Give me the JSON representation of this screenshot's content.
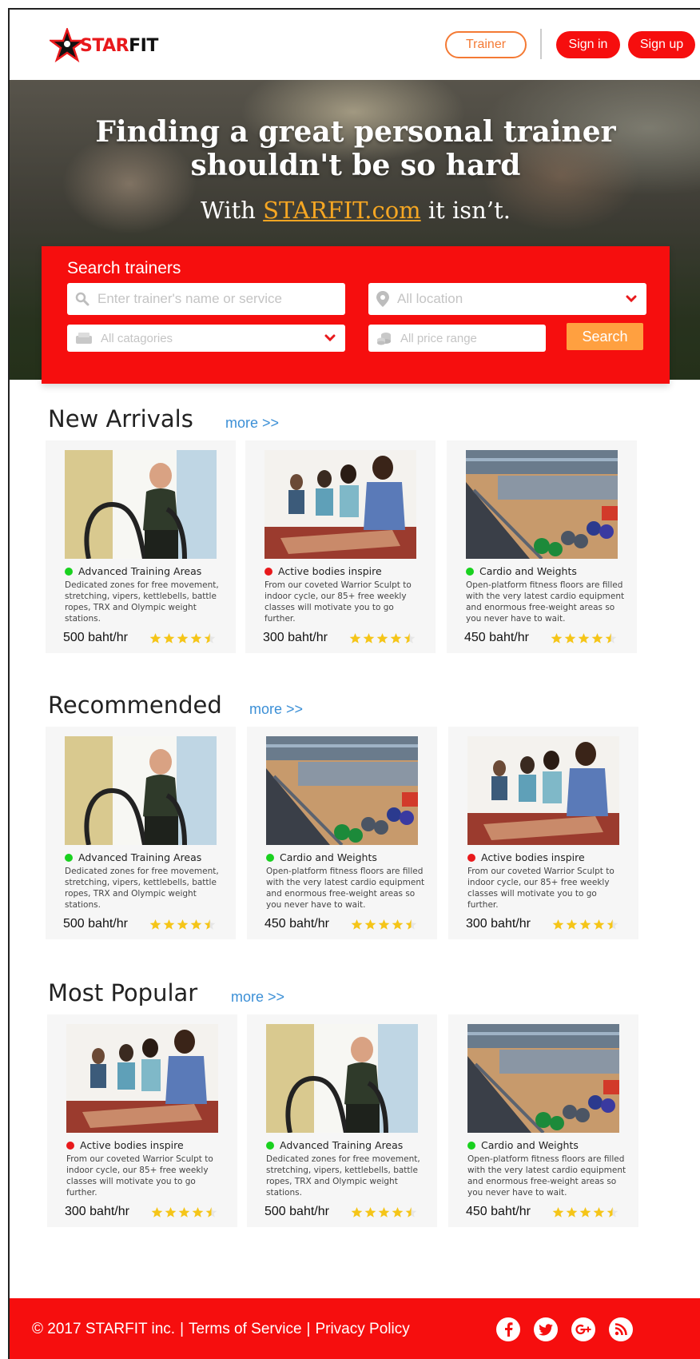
{
  "header": {
    "logo_text_prefix": "STAR",
    "logo_text_suffix": "FIT",
    "trainer_label": "Trainer",
    "signin_label": "Sign in",
    "signup_label": "Sign up"
  },
  "hero": {
    "title_line1": "Finding a great personal trainer",
    "title_line2": "shouldn't be so hard",
    "sub_prefix": "With ",
    "sub_brand": "STARFIT.com",
    "sub_suffix": " it isn’t."
  },
  "search": {
    "title": "Search trainers",
    "name_placeholder": "Enter trainer's name or service",
    "location_placeholder": "All location",
    "category_placeholder": "All catagories",
    "price_placeholder": "All price range",
    "search_label": "Search"
  },
  "colors": {
    "brand_red": "#f60e0e",
    "accent_orange": "#f47a34",
    "search_button": "#ffa040",
    "link_blue": "#3b8fd6",
    "star_yellow": "#f5c518",
    "dot_green": "#19d11f",
    "dot_red": "#e8191c"
  },
  "sections": [
    {
      "title": "New Arrivals",
      "more": "more >>",
      "cards": [
        {
          "image": "battle-ropes",
          "status": "green",
          "title": "Advanced Training Areas",
          "desc": "Dedicated zones for free movement, stretching, vipers, kettlebells, battle ropes, TRX and Olympic weight stations.",
          "price": "500 baht/hr",
          "rating": 4.5
        },
        {
          "image": "yoga-class",
          "status": "red",
          "title": "Active bodies inspire",
          "desc": "From our coveted Warrior Sculpt to indoor cycle, our 85+ free weekly classes will motivate you to go further.",
          "price": "300 baht/hr",
          "rating": 4.5
        },
        {
          "image": "gym-floor",
          "status": "green",
          "title": "Cardio and Weights",
          "desc": "Open-platform fitness floors are filled with the very latest cardio equipment and enormous free-weight areas so you never have to wait.",
          "price": "450 baht/hr",
          "rating": 4.5
        }
      ]
    },
    {
      "title": "Recommended",
      "more": "more >>",
      "cards": [
        {
          "image": "battle-ropes",
          "status": "green",
          "title": "Advanced Training Areas",
          "desc": "Dedicated zones for free movement, stretching, vipers, kettlebells, battle ropes, TRX and Olympic weight stations.",
          "price": "500 baht/hr",
          "rating": 4.5
        },
        {
          "image": "gym-floor",
          "status": "green",
          "title": "Cardio and Weights",
          "desc": "Open-platform fitness floors are filled with the very latest cardio equipment and enormous free-weight areas so you never have to wait.",
          "price": "450 baht/hr",
          "rating": 4.5
        },
        {
          "image": "yoga-class",
          "status": "red",
          "title": "Active bodies inspire",
          "desc": "From our coveted Warrior Sculpt to indoor cycle, our 85+ free weekly classes will motivate you to go further.",
          "price": "300 baht/hr",
          "rating": 4.5
        }
      ]
    },
    {
      "title": "Most Popular",
      "more": "more >>",
      "cards": [
        {
          "image": "yoga-class",
          "status": "red",
          "title": "Active bodies inspire",
          "desc": "From our coveted Warrior Sculpt to indoor cycle, our 85+ free weekly classes will motivate you to go further.",
          "price": "300 baht/hr",
          "rating": 4.5
        },
        {
          "image": "battle-ropes",
          "status": "green",
          "title": "Advanced Training Areas",
          "desc": "Dedicated zones for free movement, stretching, vipers, kettlebells, battle ropes, TRX and Olympic weight stations.",
          "price": "500 baht/hr",
          "rating": 4.5
        },
        {
          "image": "gym-floor",
          "status": "green",
          "title": "Cardio and Weights",
          "desc": "Open-platform fitness floors are filled with the very latest cardio equipment and enormous free-weight areas so you never have to wait.",
          "price": "450 baht/hr",
          "rating": 4.5
        }
      ]
    }
  ],
  "footer": {
    "copyright": "© 2017 STARFIT inc.",
    "sep": "|",
    "terms": "Terms of Service",
    "privacy": "Privacy Policy",
    "social": [
      "facebook-icon",
      "twitter-icon",
      "google-plus-icon",
      "rss-icon"
    ]
  }
}
